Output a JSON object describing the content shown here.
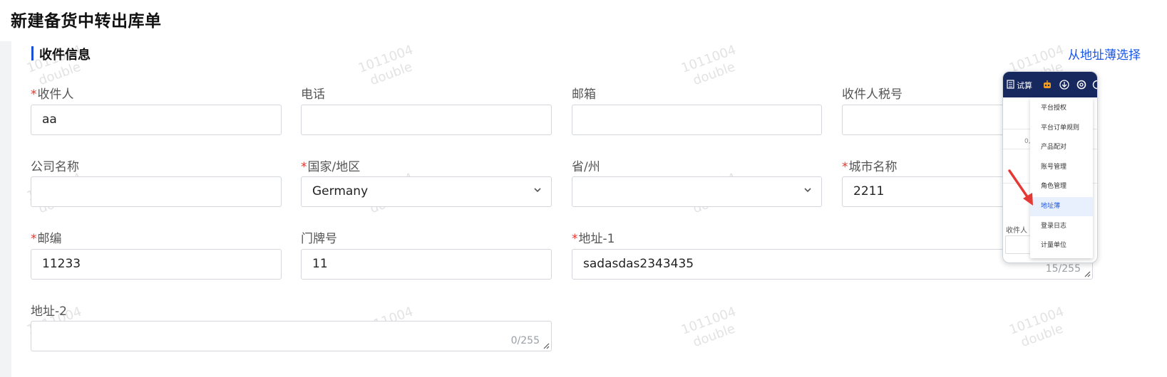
{
  "page": {
    "title": "新建备货中转出库单"
  },
  "section": {
    "title": "收件信息",
    "address_book_link": "从地址薄选择"
  },
  "fields": {
    "recipient": {
      "label": "收件人",
      "required": true,
      "value": "aa"
    },
    "phone": {
      "label": "电话",
      "required": false,
      "value": ""
    },
    "email": {
      "label": "邮箱",
      "required": false,
      "value": ""
    },
    "tax_id": {
      "label": "收件人税号",
      "required": false,
      "value": ""
    },
    "company": {
      "label": "公司名称",
      "required": false,
      "value": ""
    },
    "country": {
      "label": "国家/地区",
      "required": true,
      "value": "Germany"
    },
    "province": {
      "label": "省/州",
      "required": false,
      "value": ""
    },
    "city": {
      "label": "城市名称",
      "required": true,
      "value": "2211"
    },
    "postcode": {
      "label": "邮编",
      "required": true,
      "value": "11233"
    },
    "house_number": {
      "label": "门牌号",
      "required": false,
      "value": "11"
    },
    "address1": {
      "label": "地址-1",
      "required": true,
      "value": "sadasdas2343435",
      "counter": "15/255"
    },
    "address2": {
      "label": "地址-2",
      "required": false,
      "value": "",
      "counter": "0/255"
    }
  },
  "required_mark": "*",
  "watermark": {
    "line1": "1011004",
    "line2": "double"
  },
  "inset": {
    "toolbar_label": "试算",
    "bg_fragment_1": "0,",
    "bg_fragment_2": "收件人",
    "menu_items": [
      "平台授权",
      "平台订单规则",
      "产品配对",
      "账号管理",
      "角色管理",
      "地址薄",
      "登录日志",
      "计量单位"
    ],
    "active_index": 5,
    "icons": [
      "calculator-icon",
      "robot-icon",
      "download-icon",
      "settings-icon"
    ],
    "colors": {
      "bar": "#16285e",
      "robot": "#f29b1f",
      "arrow": "#e53935",
      "active_bg": "#e8f0fe"
    }
  },
  "colors": {
    "accent": "#1a56e8",
    "required": "#e8332a",
    "section_bar": "#1a4fd6"
  }
}
